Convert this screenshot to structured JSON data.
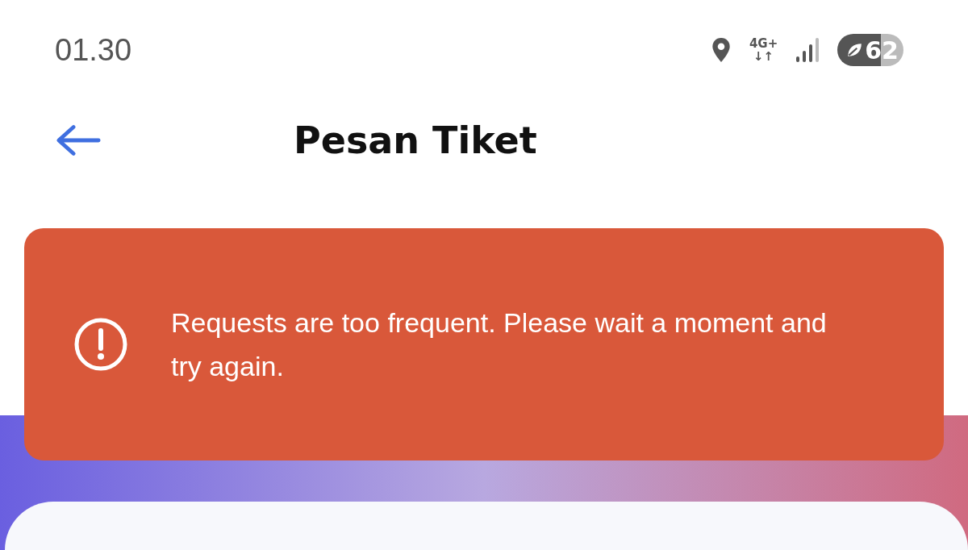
{
  "status_bar": {
    "time": "01.30",
    "network": "4G+",
    "network_arrows": "↓↑",
    "battery": "62"
  },
  "header": {
    "title": "Pesan Tiket"
  },
  "alert": {
    "kind": "error",
    "message": "Requests are too frequent. Please wait a moment and try again."
  }
}
